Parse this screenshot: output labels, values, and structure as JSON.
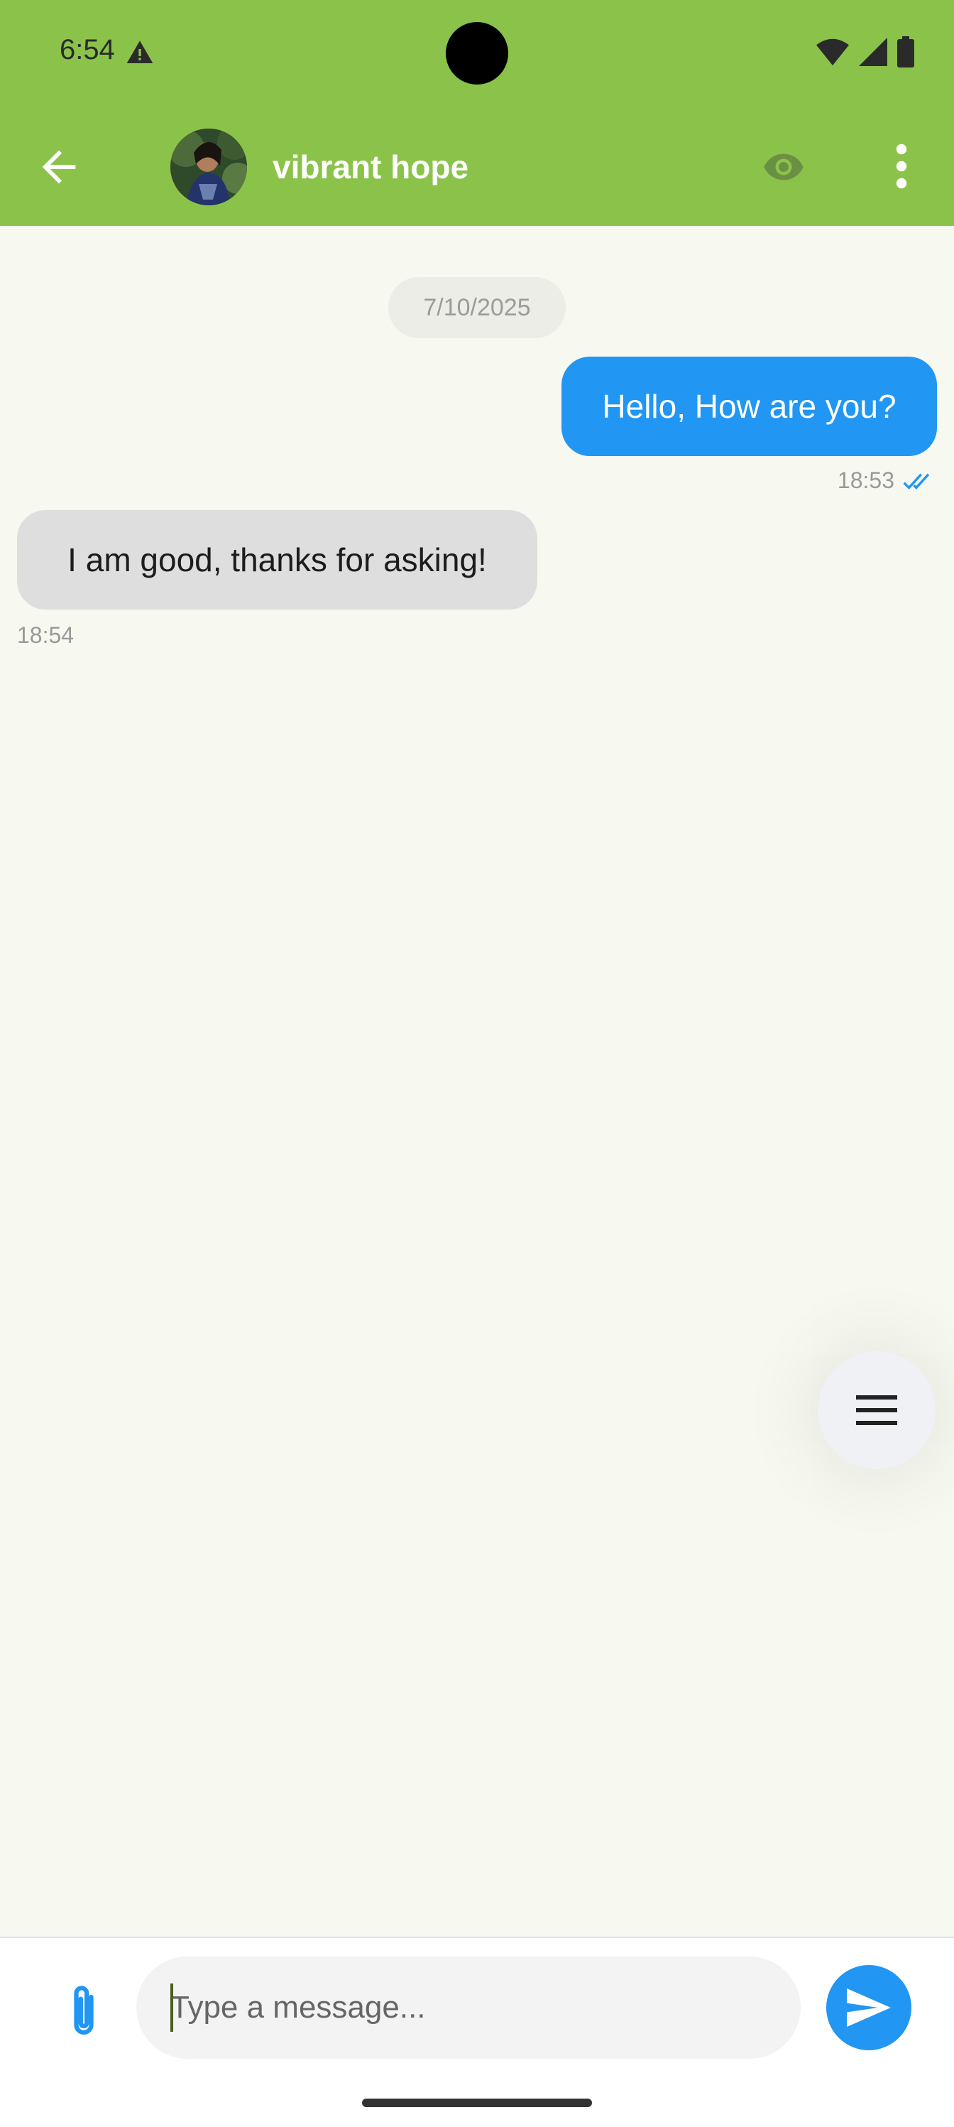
{
  "status_bar": {
    "time": "6:54"
  },
  "header": {
    "contact_name": "vibrant hope"
  },
  "chat": {
    "date_chip": "7/10/2025",
    "messages": [
      {
        "direction": "outgoing",
        "text": "Hello, How are you?",
        "time": "18:53",
        "read": true
      },
      {
        "direction": "incoming",
        "text": "I am good, thanks for asking!",
        "time": "18:54"
      }
    ]
  },
  "composer": {
    "placeholder": "Type a message..."
  },
  "colors": {
    "app_bar": "#8bc34a",
    "outgoing_bubble": "#2196f3",
    "incoming_bubble": "#dedede",
    "chat_background": "#f7f8f0"
  },
  "icons": {
    "status": [
      "warning-icon",
      "wifi-icon",
      "signal-icon",
      "battery-icon"
    ],
    "header": [
      "back-arrow-icon",
      "eye-icon",
      "more-vert-icon"
    ],
    "composer": [
      "attach-icon",
      "send-icon"
    ],
    "fab": "menu-icon"
  }
}
